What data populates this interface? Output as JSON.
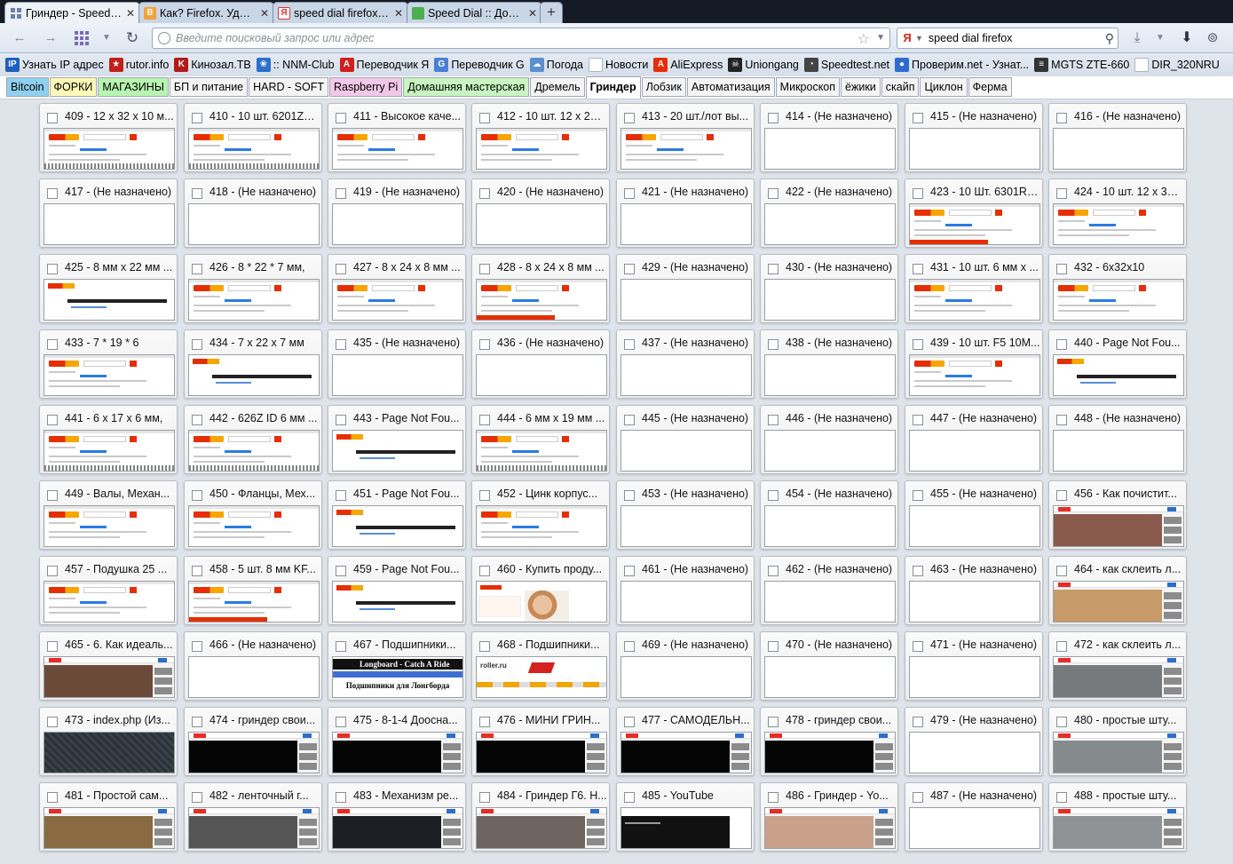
{
  "tabs": [
    {
      "title": "Гриндер - Speed ...",
      "icon": "speed-dial-grid-icon",
      "active": true
    },
    {
      "title": "Как? Firefox. Удоб...",
      "icon": "bitcoin-b-icon",
      "active": false
    },
    {
      "title": "speed dial firefox ...",
      "icon": "yandex-y-icon",
      "active": false
    },
    {
      "title": "Speed Dial :: Допо...",
      "icon": "puzzle-piece-icon",
      "active": false
    }
  ],
  "new_tab_label": "+",
  "close_glyph": "✕",
  "nav": {
    "back_icon": "back-arrow-icon",
    "forward_icon": "forward-arrow-icon",
    "url_placeholder": "Введите поисковый запрос или адрес",
    "url_value": "",
    "search_value": "speed dial firefox",
    "search_engine": "Я"
  },
  "bookmarks": [
    {
      "label": "Узнать IP адрес",
      "icon": "ip-icon",
      "color": "#1f5fbf",
      "glyph": "IP"
    },
    {
      "label": "rutor.info",
      "icon": "star-badge-icon",
      "color": "#c0201a",
      "glyph": "★"
    },
    {
      "label": "Кинозал.ТВ",
      "icon": "k-letter-icon",
      "color": "#b21a1a",
      "glyph": "K"
    },
    {
      "label": ":: NNM-Club",
      "icon": "butterfly-icon",
      "color": "#2a6fc8",
      "glyph": "❀"
    },
    {
      "label": "Переводчик Я",
      "icon": "translate-y-icon",
      "color": "#d02020",
      "glyph": "A"
    },
    {
      "label": "Переводчик G",
      "icon": "translate-g-icon",
      "color": "#4a7fd6",
      "glyph": "G"
    },
    {
      "label": "Погода",
      "icon": "weather-icon",
      "color": "#5a8fd0",
      "glyph": "☁"
    },
    {
      "label": "Новости",
      "icon": "page-icon",
      "color": "#b0b6be",
      "glyph": ""
    },
    {
      "label": "AliExpress",
      "icon": "aliexpress-icon",
      "color": "#e62e04",
      "glyph": "A"
    },
    {
      "label": "Uniongang",
      "icon": "skull-icon",
      "color": "#222222",
      "glyph": "☠"
    },
    {
      "label": "Speedtest.net",
      "icon": "speedometer-icon",
      "color": "#444444",
      "glyph": "◔"
    },
    {
      "label": "Проверим.net - Узнат...",
      "icon": "globe-icon",
      "color": "#2e6bd1",
      "glyph": "●"
    },
    {
      "label": "MGTS ZTE-660",
      "icon": "router-icon",
      "color": "#333333",
      "glyph": "≡"
    },
    {
      "label": "DIR_320NRU",
      "icon": "page-icon",
      "color": "#b0b6be",
      "glyph": ""
    }
  ],
  "groups": [
    {
      "label": "Bitcoin",
      "color": "#8fd0f0",
      "active": false
    },
    {
      "label": "ФОРКИ",
      "color": "#fff9b8",
      "active": false
    },
    {
      "label": "МАГАЗИНЫ",
      "color": "#b8f5b0",
      "active": false
    },
    {
      "label": "БП и питание",
      "color": "#f4f4f4",
      "active": false
    },
    {
      "label": "HARD - SOFT",
      "color": "#f4f4f4",
      "active": false
    },
    {
      "label": "Raspberry Pi",
      "color": "#f2c8e8",
      "active": false
    },
    {
      "label": "Домашняя мастерская",
      "color": "#c8f5c0",
      "active": false
    },
    {
      "label": "Дремель",
      "color": "#f4f4f4",
      "active": false
    },
    {
      "label": "Гриндер",
      "color": "#ffffff",
      "active": true
    },
    {
      "label": "Лобзик",
      "color": "#f4f4f4",
      "active": false
    },
    {
      "label": "Автоматизация",
      "color": "#f4f4f4",
      "active": false
    },
    {
      "label": "Микроскоп",
      "color": "#f4f4f4",
      "active": false
    },
    {
      "label": "ёжики",
      "color": "#f4f4f4",
      "active": false
    },
    {
      "label": "скайп",
      "color": "#f4f4f4",
      "active": false
    },
    {
      "label": "Циклон",
      "color": "#f4f4f4",
      "active": false
    },
    {
      "label": "Ферма",
      "color": "#f4f4f4",
      "active": false
    }
  ],
  "dials": [
    {
      "label": "409 - 12 x 32 x 10 м...",
      "thumb": "ali",
      "extra": "strip"
    },
    {
      "label": "410 - 10 шт. 6201ZZ...",
      "thumb": "ali",
      "extra": "strip"
    },
    {
      "label": "411 - Высокое каче...",
      "thumb": "ali",
      "extra": ""
    },
    {
      "label": "412 - 10 шт. 12 x 28 ...",
      "thumb": "ali",
      "extra": ""
    },
    {
      "label": "413 - 20 шт./лот вы...",
      "thumb": "ali",
      "extra": ""
    },
    {
      "label": "414 - (Не назначено)",
      "thumb": "empty",
      "extra": ""
    },
    {
      "label": "415 - (Не назначено)",
      "thumb": "empty",
      "extra": ""
    },
    {
      "label": "416 - (Не назначено)",
      "thumb": "empty",
      "extra": ""
    },
    {
      "label": "417 - (Не назначено)",
      "thumb": "empty",
      "extra": ""
    },
    {
      "label": "418 - (Не назначено)",
      "thumb": "empty",
      "extra": ""
    },
    {
      "label": "419 - (Не назначено)",
      "thumb": "empty",
      "extra": ""
    },
    {
      "label": "420 - (Не назначено)",
      "thumb": "empty",
      "extra": ""
    },
    {
      "label": "421 - (Не назначено)",
      "thumb": "empty",
      "extra": ""
    },
    {
      "label": "422 - (Не назначено)",
      "thumb": "empty",
      "extra": ""
    },
    {
      "label": "423 - 10 Шт. 6301RS...",
      "thumb": "ali",
      "extra": "red"
    },
    {
      "label": "424 - 10 шт. 12 x 32 ...",
      "thumb": "ali",
      "extra": ""
    },
    {
      "label": "425 - 8 мм x 22 мм ...",
      "thumb": "nf",
      "extra": ""
    },
    {
      "label": "426 - 8 * 22 * 7 мм,",
      "thumb": "ali",
      "extra": ""
    },
    {
      "label": "427 - 8 x 24 x 8 мм ...",
      "thumb": "ali",
      "extra": ""
    },
    {
      "label": "428 - 8 x 24 x 8 мм ...",
      "thumb": "ali",
      "extra": "red"
    },
    {
      "label": "429 - (Не назначено)",
      "thumb": "empty",
      "extra": ""
    },
    {
      "label": "430 - (Не назначено)",
      "thumb": "empty",
      "extra": ""
    },
    {
      "label": "431 - 10 шт. 6 мм x ...",
      "thumb": "ali",
      "extra": ""
    },
    {
      "label": "432 - 6x32x10",
      "thumb": "ali",
      "extra": ""
    },
    {
      "label": "433 - 7 * 19 * 6",
      "thumb": "ali",
      "extra": ""
    },
    {
      "label": "434 - 7 x 22 x 7 мм",
      "thumb": "nf",
      "extra": ""
    },
    {
      "label": "435 - (Не назначено)",
      "thumb": "empty",
      "extra": ""
    },
    {
      "label": "436 - (Не назначено)",
      "thumb": "empty",
      "extra": ""
    },
    {
      "label": "437 - (Не назначено)",
      "thumb": "empty",
      "extra": ""
    },
    {
      "label": "438 - (Не назначено)",
      "thumb": "empty",
      "extra": ""
    },
    {
      "label": "439 - 10 шт. F5 10M...",
      "thumb": "ali",
      "extra": ""
    },
    {
      "label": "440 - Page Not Fou...",
      "thumb": "nf",
      "extra": ""
    },
    {
      "label": "441 - 6 x 17 x 6 мм,",
      "thumb": "ali",
      "extra": "strip"
    },
    {
      "label": "442 - 626Z ID 6 мм ...",
      "thumb": "ali",
      "extra": "strip"
    },
    {
      "label": "443 - Page Not Fou...",
      "thumb": "nf",
      "extra": ""
    },
    {
      "label": "444 - 6 мм x 19 мм ...",
      "thumb": "ali",
      "extra": "strip"
    },
    {
      "label": "445 - (Не назначено)",
      "thumb": "empty",
      "extra": ""
    },
    {
      "label": "446 - (Не назначено)",
      "thumb": "empty",
      "extra": ""
    },
    {
      "label": "447 - (Не назначено)",
      "thumb": "empty",
      "extra": ""
    },
    {
      "label": "448 - (Не назначено)",
      "thumb": "empty",
      "extra": ""
    },
    {
      "label": "449 - Валы, Механ...",
      "thumb": "ali",
      "extra": ""
    },
    {
      "label": "450 - Фланцы, Мех...",
      "thumb": "ali",
      "extra": ""
    },
    {
      "label": "451 - Page Not Fou...",
      "thumb": "nf",
      "extra": ""
    },
    {
      "label": "452 - Цинк корпус...",
      "thumb": "ali",
      "extra": ""
    },
    {
      "label": "453 - (Не назначено)",
      "thumb": "empty",
      "extra": ""
    },
    {
      "label": "454 - (Не назначено)",
      "thumb": "empty",
      "extra": ""
    },
    {
      "label": "455 - (Не назначено)",
      "thumb": "empty",
      "extra": ""
    },
    {
      "label": "456 - Как почистит...",
      "thumb": "yt",
      "video": "#8a5a4c",
      "extra": ""
    },
    {
      "label": "457 - Подушка 25 ...",
      "thumb": "ali",
      "extra": ""
    },
    {
      "label": "458 - 5 шт. 8 мм KF...",
      "thumb": "ali",
      "extra": "red"
    },
    {
      "label": "459 - Page Not Fou...",
      "thumb": "nf",
      "extra": ""
    },
    {
      "label": "460 - Купить проду...",
      "thumb": "promo",
      "extra": ""
    },
    {
      "label": "461 - (Не назначено)",
      "thumb": "empty",
      "extra": ""
    },
    {
      "label": "462 - (Не назначено)",
      "thumb": "empty",
      "extra": ""
    },
    {
      "label": "463 - (Не назначено)",
      "thumb": "empty",
      "extra": ""
    },
    {
      "label": "464 - как склеить л...",
      "thumb": "yt",
      "video": "#c79a6a",
      "extra": ""
    },
    {
      "label": "465 - 6. Как идеаль...",
      "thumb": "yt",
      "video": "#6b4a3a",
      "extra": ""
    },
    {
      "label": "466 - (Не назначено)",
      "thumb": "empty",
      "extra": ""
    },
    {
      "label": "467 - Подшипники...",
      "thumb": "longboard",
      "extra": ""
    },
    {
      "label": "468 - Подшипники...",
      "thumb": "roller",
      "extra": ""
    },
    {
      "label": "469 - (Не назначено)",
      "thumb": "empty",
      "extra": ""
    },
    {
      "label": "470 - (Не назначено)",
      "thumb": "empty",
      "extra": ""
    },
    {
      "label": "471 - (Не назначено)",
      "thumb": "empty",
      "extra": ""
    },
    {
      "label": "472 - как склеить л...",
      "thumb": "yt",
      "video": "#777a7d",
      "extra": ""
    },
    {
      "label": "473 - index.php (Из...",
      "thumb": "dark",
      "extra": ""
    },
    {
      "label": "474 - гриндер свои...",
      "thumb": "yt",
      "video": "#050505",
      "extra": ""
    },
    {
      "label": "475 - 8-1-4 Доосна...",
      "thumb": "yt",
      "video": "#050505",
      "extra": ""
    },
    {
      "label": "476 - МИНИ ГРИН...",
      "thumb": "yt",
      "video": "#050505",
      "extra": ""
    },
    {
      "label": "477 - САМОДЕЛЬН...",
      "thumb": "yt",
      "video": "#050505",
      "extra": ""
    },
    {
      "label": "478 - гриндер свои...",
      "thumb": "yt",
      "video": "#050505",
      "extra": ""
    },
    {
      "label": "479 - (Не назначено)",
      "thumb": "empty",
      "extra": ""
    },
    {
      "label": "480 - простые шту...",
      "thumb": "yt",
      "video": "#858a8c",
      "extra": ""
    },
    {
      "label": "481 - Простой сам...",
      "thumb": "yt",
      "video": "#8a6a40",
      "extra": ""
    },
    {
      "label": "482 - ленточный г...",
      "thumb": "yt",
      "video": "#565656",
      "extra": ""
    },
    {
      "label": "483 - Механизм ре...",
      "thumb": "yt",
      "video": "#1d1f24",
      "extra": ""
    },
    {
      "label": "484 - Гриндер Г6. Н...",
      "thumb": "yt",
      "video": "#6f6560",
      "extra": ""
    },
    {
      "label": "485 - YouTube",
      "thumb": "ytblank",
      "extra": ""
    },
    {
      "label": "486 - Гриндер - Yo...",
      "thumb": "yt",
      "video": "#c9a08a",
      "extra": ""
    },
    {
      "label": "487 - (Не назначено)",
      "thumb": "empty",
      "extra": ""
    },
    {
      "label": "488 - простые шту...",
      "thumb": "yt",
      "video": "#8f9396",
      "extra": ""
    }
  ],
  "longboard": {
    "title": "Longboard - Catch A Ride",
    "subtitle": "Подшипники для Лонгборда"
  },
  "roller_logo": "roller.ru",
  "not_found_text": "К сожалению, запрашиваемая вами страница не найдена!"
}
